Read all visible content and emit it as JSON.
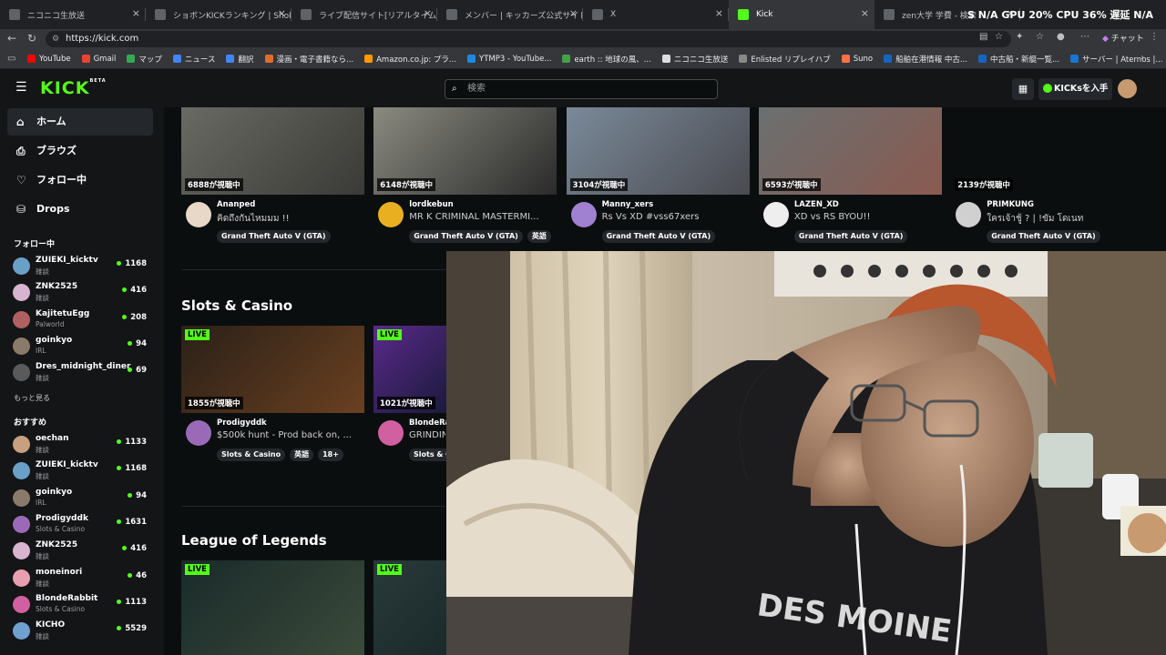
{
  "browser": {
    "tabs": [
      {
        "label": "ニコニコ生放送"
      },
      {
        "label": "ショボンKICKランキング | Shobon Kick"
      },
      {
        "label": "ライブ配信サイト[リアルタイムランキング]"
      },
      {
        "label": "メンバー | キッカーズ公式サイト"
      },
      {
        "label": "X"
      },
      {
        "label": "Kick"
      },
      {
        "label": "zen大学 学費 - 検索"
      }
    ],
    "active_tab": 5,
    "sys_stats": "S N/A  GPU 20%  CPU 36%  遅延 N/A",
    "url": "https://kick.com",
    "chat_label": "チャット",
    "bookmarks": [
      "YouTube",
      "Gmail",
      "マップ",
      "ニュース",
      "翻訳",
      "漫画・電子書籍なら...",
      "Amazon.co.jp: プラ...",
      "YTMP3 - YouTube...",
      "earth :: 地球の風、...",
      "ニコニコ生放送",
      "Enlisted リプレイハブ",
      "Suno",
      "船舶在港情報 中古...",
      "中古船・新艇一覧...",
      "サーバー | Aternos |..."
    ],
    "bookmark_colors": [
      "#ff0000",
      "#ea4335",
      "#34a853",
      "#4285f4",
      "#4285f4",
      "#e06c2b",
      "#ff9900",
      "#1e88e5",
      "#43a047",
      "#dddddd",
      "#888888",
      "#ff7043",
      "#1565c0",
      "#1565c0",
      "#1976d2"
    ]
  },
  "header": {
    "logo": "KICK",
    "logo_sup": "BETA",
    "search_placeholder": "検索",
    "get_kicks": "KICKsを入手"
  },
  "sidebar": {
    "nav": [
      {
        "label": "ホーム",
        "icon": "home-icon"
      },
      {
        "label": "ブラウズ",
        "icon": "browse-icon"
      },
      {
        "label": "フォロー中",
        "icon": "heart-icon"
      },
      {
        "label": "Drops",
        "icon": "drops-icon"
      }
    ],
    "following_title": "フォロー中",
    "following": [
      {
        "name": "ZUIEKI_kicktv",
        "category": "雑談",
        "viewers": "1168",
        "color": "#6aa0c8"
      },
      {
        "name": "ZNK2525",
        "category": "雑談",
        "viewers": "416",
        "color": "#d8b4d0"
      },
      {
        "name": "KajitetuEgg",
        "category": "Palworld",
        "viewers": "208",
        "color": "#b06060"
      },
      {
        "name": "goinkyo",
        "category": "IRL",
        "viewers": "94",
        "color": "#8a7a6a"
      },
      {
        "name": "Dres_midnight_diner",
        "category": "雑談",
        "viewers": "69",
        "color": "#5a5a5a"
      }
    ],
    "show_more": "もっと見る",
    "recommended_title": "おすすめ",
    "recommended": [
      {
        "name": "oechan",
        "category": "雑談",
        "viewers": "1133",
        "color": "#c8a080"
      },
      {
        "name": "ZUIEKI_kicktv",
        "category": "雑談",
        "viewers": "1168",
        "color": "#6aa0c8"
      },
      {
        "name": "goinkyo",
        "category": "IRL",
        "viewers": "94",
        "color": "#8a7a6a"
      },
      {
        "name": "Prodigyddk",
        "category": "Slots & Casino",
        "viewers": "1631",
        "color": "#9a6ab8"
      },
      {
        "name": "ZNK2525",
        "category": "雑談",
        "viewers": "416",
        "color": "#d8b4d0"
      },
      {
        "name": "moneinori",
        "category": "雑談",
        "viewers": "46",
        "color": "#e8a0b0"
      },
      {
        "name": "BlondeRabbit",
        "category": "Slots & Casino",
        "viewers": "1113",
        "color": "#d060a0"
      },
      {
        "name": "KICHO",
        "category": "雑談",
        "viewers": "5529",
        "color": "#70a0d0"
      }
    ]
  },
  "top_streams": [
    {
      "viewers": "6888が視聴中",
      "streamer": "Ananped",
      "title": "คิดถึงกันไหมมม !!",
      "tags": [
        "Grand Theft Auto V (GTA)"
      ],
      "avatar": "#e8d8c8"
    },
    {
      "viewers": "6148が視聴中",
      "streamer": "lordkebun",
      "title": "MR K CRIMINAL MASTERMI...",
      "tags": [
        "Grand Theft Auto V (GTA)",
        "英語"
      ],
      "avatar": "#e8b020"
    },
    {
      "viewers": "3104が視聴中",
      "streamer": "Manny_xers",
      "title": "Rs Vs XD #vss67xers",
      "tags": [
        "Grand Theft Auto V (GTA)"
      ],
      "avatar": "#a080d0"
    },
    {
      "viewers": "6593が視聴中",
      "streamer": "LAZEN_XD",
      "title": "XD vs RS BYOU!!",
      "tags": [
        "Grand Theft Auto V (GTA)"
      ],
      "avatar": "#eeeeee"
    },
    {
      "viewers": "2139が視聴中",
      "streamer": "PRIMKUNG",
      "title": "ใครเจ้าชู้ ? | !ขัม โดเนท",
      "tags": [
        "Grand Theft Auto V (GTA)"
      ],
      "avatar": "#d0d0d0"
    }
  ],
  "slots_section": {
    "title": "Slots & Casino",
    "live_label": "LIVE",
    "streams": [
      {
        "viewers": "1855が視聴中",
        "streamer": "Prodigyddk",
        "title": "$500k hunt - Prod back on, ...",
        "tags": [
          "Slots & Casino",
          "英語",
          "18+"
        ],
        "avatar": "#9a6ab8"
      },
      {
        "viewers": "1021が視聴中",
        "streamer": "BlondeRa",
        "title": "GRINDIN",
        "tags": [
          "Slots & C"
        ],
        "avatar": "#d060a0"
      }
    ]
  },
  "lol_section": {
    "title": "League of Legends",
    "live_label": "LIVE"
  }
}
